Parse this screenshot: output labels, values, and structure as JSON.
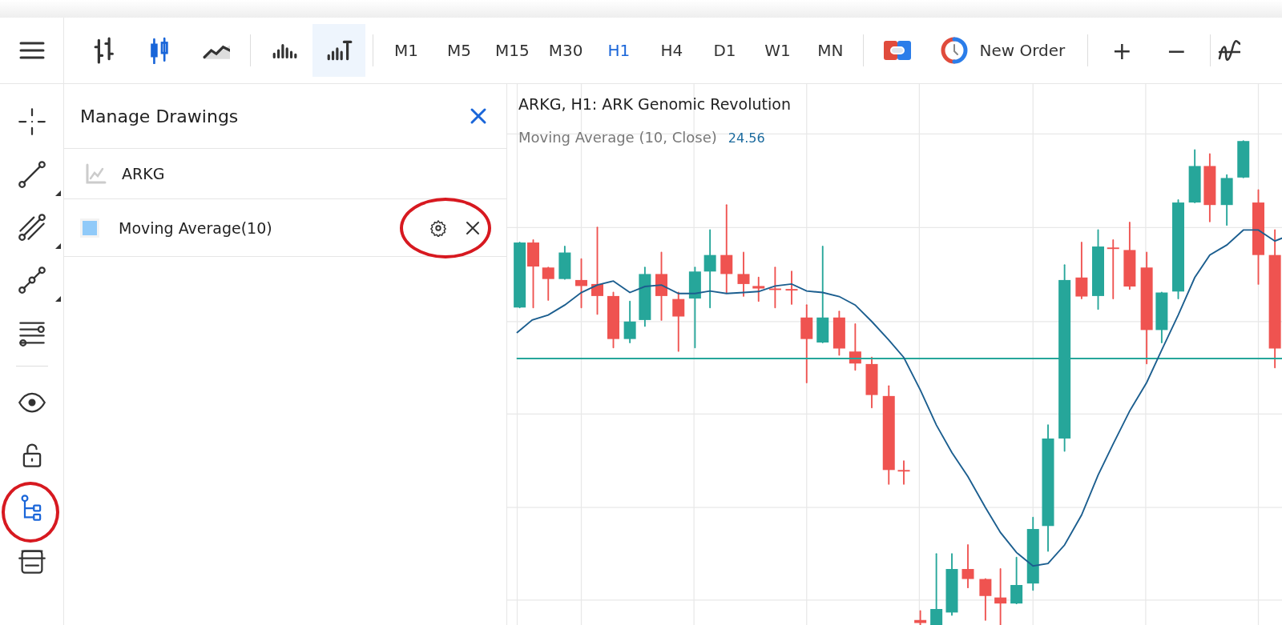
{
  "toolbar": {
    "chart_types": [
      {
        "kind": "bars",
        "selected": false
      },
      {
        "kind": "candles",
        "selected": true
      },
      {
        "kind": "line",
        "selected": false
      }
    ],
    "volume_tools": [
      {
        "kind": "volume",
        "active": false
      },
      {
        "kind": "tick_volume",
        "active": true
      }
    ],
    "timeframes": [
      {
        "label": "M1",
        "selected": false
      },
      {
        "label": "M5",
        "selected": false
      },
      {
        "label": "M15",
        "selected": false
      },
      {
        "label": "M30",
        "selected": false
      },
      {
        "label": "H1",
        "selected": true
      },
      {
        "label": "H4",
        "selected": false
      },
      {
        "label": "D1",
        "selected": false
      },
      {
        "label": "W1",
        "selected": false
      },
      {
        "label": "MN",
        "selected": false
      }
    ],
    "new_order": {
      "label": "New Order"
    },
    "zoom_buttons": [
      {
        "label": "+"
      },
      {
        "label": "−"
      }
    ]
  },
  "sidebar": {
    "tool_groups": [
      [
        {
          "kind": "crosshair",
          "selected": false,
          "submenu": false
        },
        {
          "kind": "trendline",
          "selected": false,
          "submenu": true
        },
        {
          "kind": "channel",
          "selected": false,
          "submenu": true
        },
        {
          "kind": "polyline",
          "selected": false,
          "submenu": true
        },
        {
          "kind": "levels",
          "selected": false,
          "submenu": false
        }
      ],
      [
        {
          "kind": "eye",
          "selected": false,
          "submenu": false
        },
        {
          "kind": "lock",
          "selected": false,
          "submenu": false
        },
        {
          "kind": "tree",
          "selected": true,
          "submenu": false
        },
        {
          "kind": "layers",
          "selected": false,
          "submenu": false
        }
      ]
    ]
  },
  "panel": {
    "title": "Manage Drawings",
    "items": [
      {
        "kind": "symbol",
        "label": "ARKG"
      },
      {
        "kind": "indicator",
        "label": "Moving Average(10)",
        "color": "#90caf9"
      }
    ]
  },
  "chart": {
    "title": "ARKG, H1: ARK Genomic Revolution",
    "indicator": {
      "label": "Moving Average (10, Close)",
      "value": "24.56"
    }
  }
}
